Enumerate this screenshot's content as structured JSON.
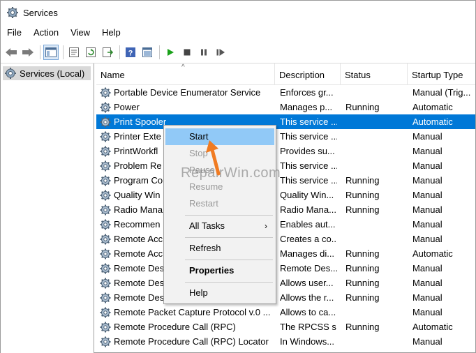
{
  "window": {
    "title": "Services"
  },
  "menubar": [
    "File",
    "Action",
    "View",
    "Help"
  ],
  "toolbar_icons": [
    "back-arrow-icon",
    "forward-arrow-icon",
    "show-hide-tree-icon",
    "properties-icon",
    "refresh-icon",
    "export-list-icon",
    "help-icon",
    "console-icon",
    "start-service-icon",
    "stop-service-icon",
    "pause-service-icon",
    "restart-service-icon"
  ],
  "tree": {
    "root_label": "Services (Local)"
  },
  "columns": {
    "name": "Name",
    "description": "Description",
    "status": "Status",
    "startup": "Startup Type"
  },
  "services": [
    {
      "name": "Portable Device Enumerator Service",
      "description": "Enforces gr...",
      "status": "",
      "startup": "Manual (Trig..."
    },
    {
      "name": "Power",
      "description": "Manages p...",
      "status": "Running",
      "startup": "Automatic"
    },
    {
      "name": "Print Spooler",
      "description": "This service ...",
      "status": "",
      "startup": "Automatic",
      "selected": true
    },
    {
      "name": "Printer Exte",
      "description": "This service ...",
      "status": "",
      "startup": "Manual"
    },
    {
      "name": "PrintWorkfl",
      "description": "Provides su...",
      "status": "",
      "startup": "Manual"
    },
    {
      "name": "Problem Re",
      "description": "This service ...",
      "status": "",
      "startup": "Manual"
    },
    {
      "name": "Program Co",
      "description": "This service ...",
      "status": "Running",
      "startup": "Manual"
    },
    {
      "name": "Quality Win",
      "description": "Quality Win...",
      "status": "Running",
      "startup": "Manual"
    },
    {
      "name": "Radio Mana",
      "description": "Radio Mana...",
      "status": "Running",
      "startup": "Manual"
    },
    {
      "name": "Recommen",
      "description": "Enables aut...",
      "status": "",
      "startup": "Manual"
    },
    {
      "name": "Remote Acc",
      "description": "Creates a co...",
      "status": "",
      "startup": "Manual"
    },
    {
      "name": "Remote Acc",
      "description": "Manages di...",
      "status": "Running",
      "startup": "Automatic"
    },
    {
      "name": "Remote Des",
      "description": "Remote Des...",
      "status": "Running",
      "startup": "Manual"
    },
    {
      "name": "Remote Des",
      "description": "Allows user...",
      "status": "Running",
      "startup": "Manual"
    },
    {
      "name": "Remote Des",
      "description": "Allows the r...",
      "status": "Running",
      "startup": "Manual"
    },
    {
      "name": "Remote Packet Capture Protocol v.0 ...",
      "description": "Allows to ca...",
      "status": "",
      "startup": "Manual"
    },
    {
      "name": "Remote Procedure Call (RPC)",
      "description": "The RPCSS s...",
      "status": "Running",
      "startup": "Automatic"
    },
    {
      "name": "Remote Procedure Call (RPC) Locator",
      "description": "In Windows...",
      "status": "",
      "startup": "Manual"
    }
  ],
  "context_menu": {
    "start": "Start",
    "stop": "Stop",
    "pause": "Pause",
    "resume": "Resume",
    "restart": "Restart",
    "all_tasks": "All Tasks",
    "refresh": "Refresh",
    "properties": "Properties",
    "help": "Help"
  },
  "watermark": "RepairWin.com",
  "colors": {
    "selection": "#0078d7",
    "menu_highlight": "#91c9f7",
    "arrow": "#f07b22",
    "play_green": "#1aa11a"
  }
}
